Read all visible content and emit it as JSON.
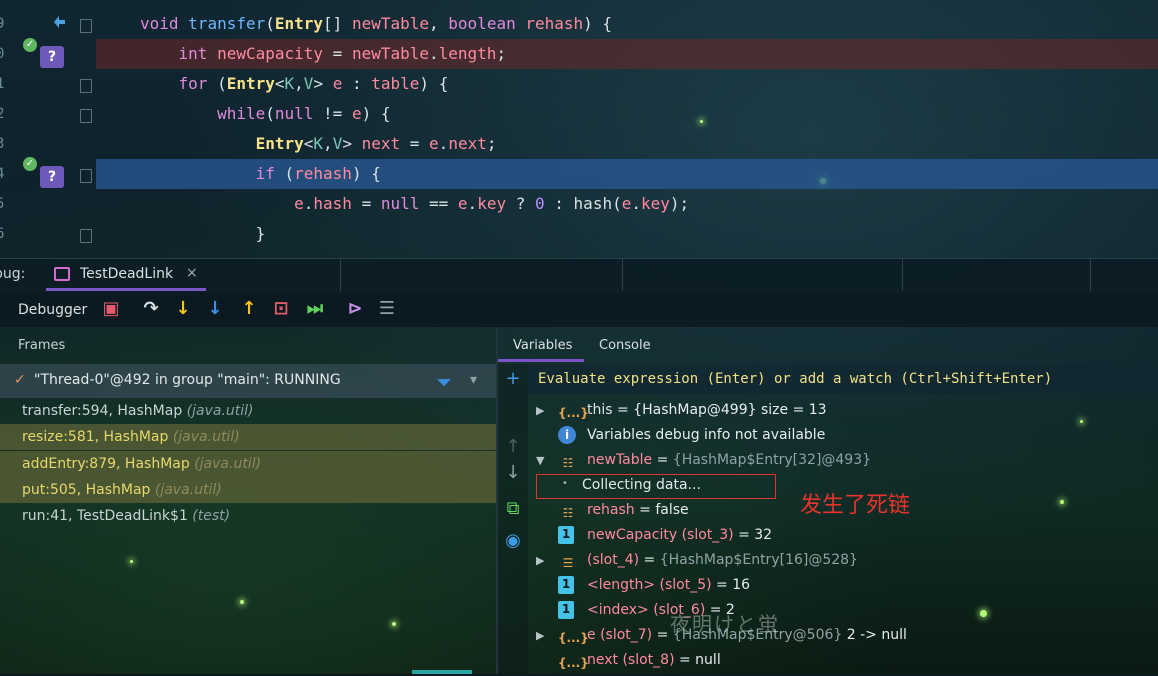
{
  "editor": {
    "line_numbers": [
      "9",
      "0",
      "1",
      "2",
      "3",
      "4",
      "5",
      "6"
    ],
    "lines": [
      {
        "tokens": [
          [
            "kw",
            "void "
          ],
          [
            "fn",
            "transfer"
          ],
          [
            "pl",
            "("
          ],
          [
            "ty",
            "Entry"
          ],
          [
            "pl",
            "[] "
          ],
          [
            "va",
            "newTable"
          ],
          [
            "pl",
            ", "
          ],
          [
            "kw",
            "boolean "
          ],
          [
            "va",
            "rehash"
          ],
          [
            "pl",
            ") {"
          ]
        ]
      },
      {
        "tokens": [
          [
            "pl",
            "    "
          ],
          [
            "kw",
            "int "
          ],
          [
            "va",
            "newCapacity"
          ],
          [
            "pl",
            " = "
          ],
          [
            "va",
            "newTable"
          ],
          [
            "pl",
            "."
          ],
          [
            "va",
            "length"
          ],
          [
            "pl",
            ";"
          ]
        ]
      },
      {
        "tokens": [
          [
            "pl",
            "    "
          ],
          [
            "kw",
            "for "
          ],
          [
            "pl",
            "("
          ],
          [
            "ty",
            "Entry"
          ],
          [
            "pl",
            "<"
          ],
          [
            "gn",
            "K"
          ],
          [
            "pl",
            ","
          ],
          [
            "gn",
            "V"
          ],
          [
            "pl",
            "> "
          ],
          [
            "va",
            "e"
          ],
          [
            "pl",
            " : "
          ],
          [
            "va",
            "table"
          ],
          [
            "pl",
            ") {"
          ]
        ]
      },
      {
        "tokens": [
          [
            "pl",
            "        "
          ],
          [
            "kw",
            "while"
          ],
          [
            "pl",
            "("
          ],
          [
            "kw",
            "null"
          ],
          [
            "pl",
            " != "
          ],
          [
            "va",
            "e"
          ],
          [
            "pl",
            ") {"
          ]
        ]
      },
      {
        "tokens": [
          [
            "pl",
            "            "
          ],
          [
            "ty",
            "Entry"
          ],
          [
            "pl",
            "<"
          ],
          [
            "gn",
            "K"
          ],
          [
            "pl",
            ","
          ],
          [
            "gn",
            "V"
          ],
          [
            "pl",
            "> "
          ],
          [
            "va",
            "next"
          ],
          [
            "pl",
            " = "
          ],
          [
            "va",
            "e"
          ],
          [
            "pl",
            "."
          ],
          [
            "va",
            "next"
          ],
          [
            "pl",
            ";"
          ]
        ]
      },
      {
        "tokens": [
          [
            "pl",
            "            "
          ],
          [
            "kw",
            "if "
          ],
          [
            "pl",
            "("
          ],
          [
            "va",
            "rehash"
          ],
          [
            "pl",
            ") {"
          ]
        ]
      },
      {
        "tokens": [
          [
            "pl",
            "                "
          ],
          [
            "va",
            "e"
          ],
          [
            "pl",
            "."
          ],
          [
            "va",
            "hash"
          ],
          [
            "pl",
            " = "
          ],
          [
            "kw",
            "null"
          ],
          [
            "pl",
            " == "
          ],
          [
            "va",
            "e"
          ],
          [
            "pl",
            "."
          ],
          [
            "va",
            "key"
          ],
          [
            "pl",
            " ? "
          ],
          [
            "nu",
            "0"
          ],
          [
            "pl",
            " : "
          ],
          [
            "pl",
            "hash("
          ],
          [
            "va",
            "e"
          ],
          [
            "pl",
            "."
          ],
          [
            "va",
            "key"
          ],
          [
            "pl",
            ");"
          ]
        ]
      },
      {
        "tokens": [
          [
            "pl",
            "            }"
          ]
        ]
      }
    ],
    "breakpoint_badge": "?"
  },
  "debug": {
    "panel_label": "bug:",
    "session_tab": "TestDeadLink",
    "tab_close": "×",
    "toolbar_label": "Debugger"
  },
  "frames": {
    "title": "Frames",
    "thread": "\"Thread-0\"@492 in group \"main\": RUNNING",
    "rows": [
      {
        "method": "transfer:594, HashMap ",
        "pkg": "(java.util)"
      },
      {
        "method": "resize:581, HashMap ",
        "pkg": "(java.util)"
      },
      {
        "method": "addEntry:879, HashMap ",
        "pkg": "(java.util)"
      },
      {
        "method": "put:505, HashMap ",
        "pkg": "(java.util)"
      },
      {
        "method": "run:41, TestDeadLink$1 ",
        "pkg": "(test)"
      }
    ]
  },
  "variables": {
    "tabs": [
      "Variables",
      "Console"
    ],
    "eval_placeholder": "Evaluate expression (Enter) or add a watch (Ctrl+Shift+Enter)",
    "rows": [
      {
        "name": "this",
        "val": " = {HashMap@499}  size = 13"
      },
      {
        "info": "Variables debug info not available"
      },
      {
        "name": "newTable",
        "val": " = ",
        "gray": "{HashMap$Entry[32]@493}"
      },
      {
        "collect": "Collecting data..."
      },
      {
        "name": "rehash",
        "val": " = false"
      },
      {
        "name": "newCapacity (slot_3)",
        "val": " = 32"
      },
      {
        "name": " (slot_4)",
        "val": " = ",
        "gray": "{HashMap$Entry[16]@528}"
      },
      {
        "name": "<length> (slot_5)",
        "val": " = 16"
      },
      {
        "name": "<index> (slot_6)",
        "val": " = 2"
      },
      {
        "name": "e (slot_7)",
        "val": " = ",
        "gray": "{HashMap$Entry@506}",
        "tail": " 2 -> null"
      },
      {
        "name": "next (slot_8)",
        "val": " = null"
      }
    ],
    "annotation": "发生了死链",
    "watermark": "夜明けと蛍"
  },
  "colors": {
    "accent": "#7b54c7",
    "breakpoint": "#6c59b8",
    "annotation": "#e5332d"
  }
}
